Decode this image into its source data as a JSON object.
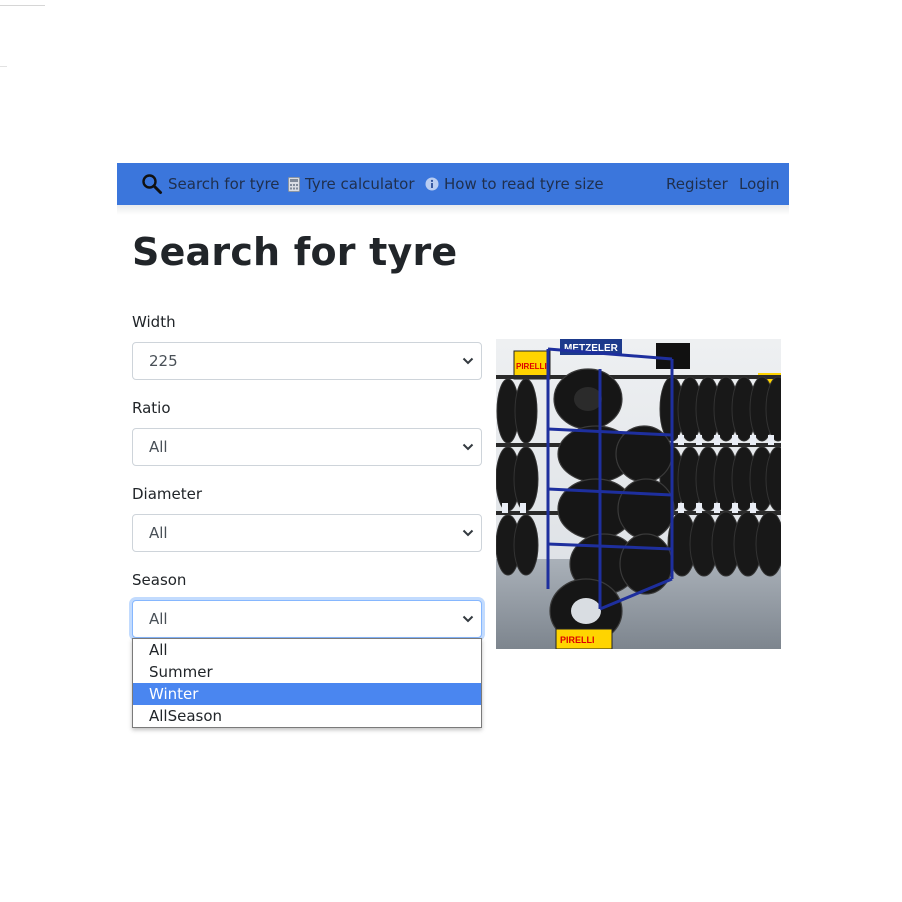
{
  "nav": {
    "search_label": "Search for tyre",
    "calculator_label": "Tyre calculator",
    "read_size_label": "How to read tyre size",
    "register_label": "Register",
    "login_label": "Login",
    "search_icon": "search-icon",
    "calculator_icon": "calculator-icon",
    "info_icon": "info-icon"
  },
  "page": {
    "title": "Search for tyre"
  },
  "form": {
    "width": {
      "label": "Width",
      "value": "225"
    },
    "ratio": {
      "label": "Ratio",
      "value": "All"
    },
    "diameter": {
      "label": "Diameter",
      "value": "All"
    },
    "season": {
      "label": "Season",
      "value": "All"
    }
  },
  "season_dropdown": {
    "options": [
      "All",
      "Summer",
      "Winter",
      "AllSeason"
    ],
    "highlighted": "Winter"
  },
  "photo": {
    "sign_metzeler": "METZELER",
    "sign_pirelli": "PIRELLI",
    "sign_brand": "PIRELLI"
  },
  "colors": {
    "navbar": "#3b76dc",
    "highlight": "#4a86f0",
    "rack": "#1e2f9e"
  }
}
